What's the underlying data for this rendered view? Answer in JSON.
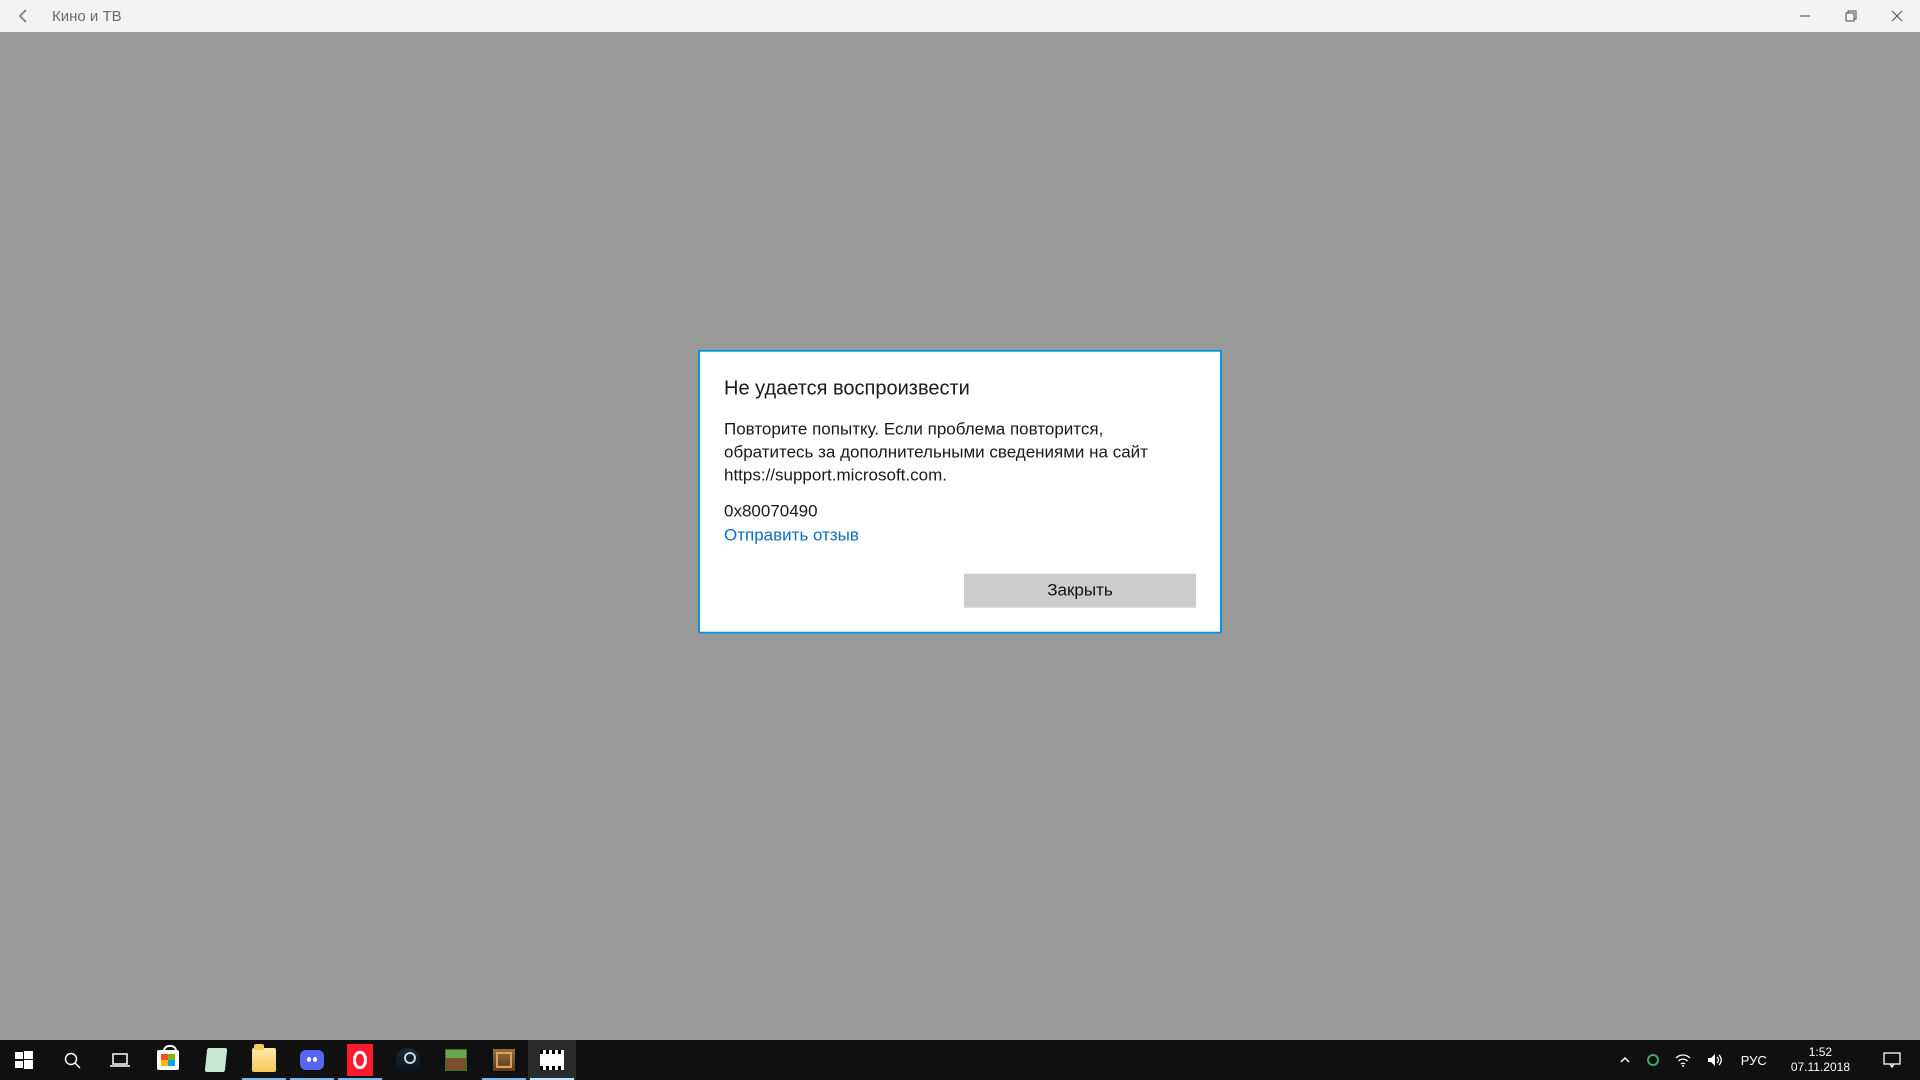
{
  "app": {
    "title": "Кино и ТВ"
  },
  "dialog": {
    "title": "Не удается воспроизвести",
    "message": "Повторите попытку. Если проблема повторится, обратитесь за дополнительными сведениями на сайт https://support.microsoft.com.",
    "error_code": "0x80070490",
    "feedback_link": "Отправить отзыв",
    "close_button": "Закрыть"
  },
  "taskbar": {
    "lang": "РУС",
    "time": "1:52",
    "date": "07.11.2018"
  }
}
